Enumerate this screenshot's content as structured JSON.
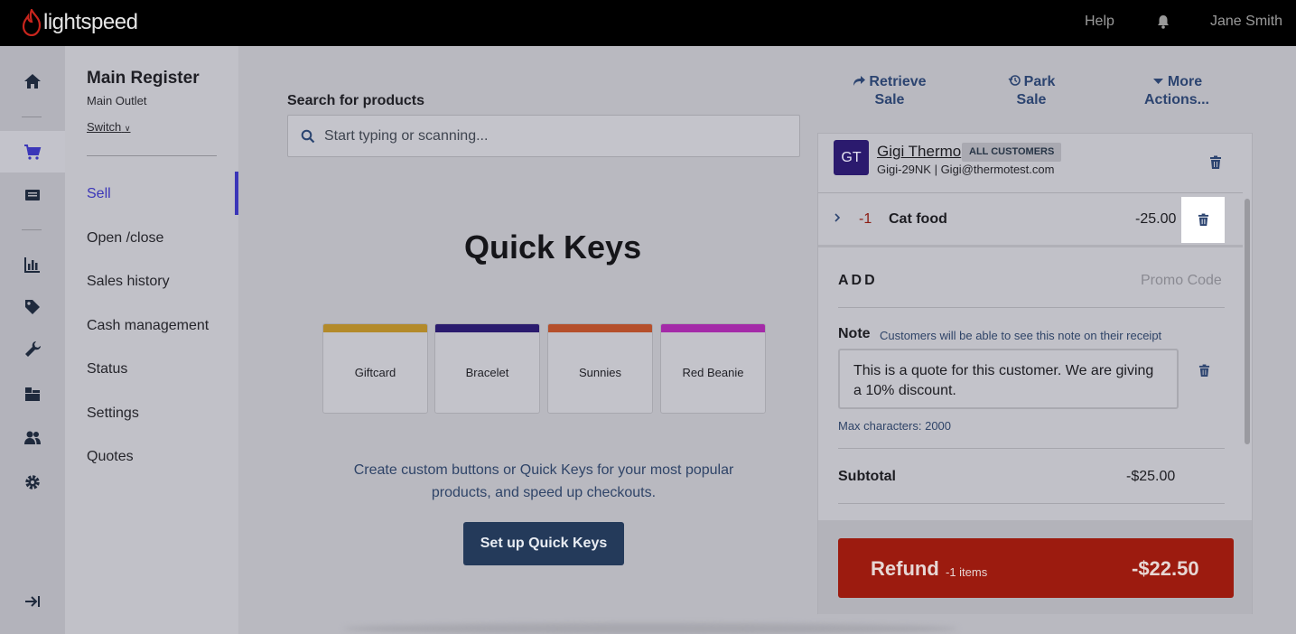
{
  "topbar": {
    "brand": "lightspeed",
    "help": "Help",
    "user": "Jane Smith"
  },
  "register": {
    "title": "Main Register",
    "outlet": "Main Outlet",
    "switch_label": "Switch"
  },
  "nav": {
    "items": [
      {
        "label": "Sell"
      },
      {
        "label": "Open /close"
      },
      {
        "label": "Sales history"
      },
      {
        "label": "Cash management"
      },
      {
        "label": "Status"
      },
      {
        "label": "Settings"
      },
      {
        "label": "Quotes"
      }
    ]
  },
  "search": {
    "label": "Search for products",
    "placeholder": "Start typing or scanning..."
  },
  "quick_keys": {
    "title": "Quick Keys",
    "keys": [
      {
        "label": "Giftcard",
        "color": "#b38a2a"
      },
      {
        "label": "Bracelet",
        "color": "#2a1b6e"
      },
      {
        "label": "Sunnies",
        "color": "#b54f2b"
      },
      {
        "label": "Red Beanie",
        "color": "#a42aa8"
      }
    ],
    "description": "Create custom buttons or Quick Keys for your most popular products, and speed up checkouts.",
    "setup_button": "Set up Quick Keys"
  },
  "actions": {
    "retrieve": "Retrieve Sale",
    "park": "Park Sale",
    "more": "More Actions..."
  },
  "customer": {
    "initials": "GT",
    "name": "Gigi Thermo",
    "badge": "ALL CUSTOMERS",
    "meta": "Gigi-29NK | Gigi@thermotest.com"
  },
  "line_item": {
    "qty": "-1",
    "name": "Cat food",
    "price": "-25.00"
  },
  "add": {
    "label": "ADD",
    "promo": "Promo Code"
  },
  "note": {
    "label": "Note",
    "hint": "Customers will be able to see this note on their receipt",
    "text": "This is a quote for this customer. We are giving a 10% discount.",
    "max_chars": "Max characters: 2000"
  },
  "totals": {
    "subtotal_label": "Subtotal",
    "subtotal_value": "-$25.00"
  },
  "refund": {
    "label": "Refund",
    "items": "-1 items",
    "total": "-$22.50"
  },
  "colors": {
    "accent": "#3b36b8",
    "refund": "#9c1b0f",
    "primary_button": "#243a5a"
  }
}
